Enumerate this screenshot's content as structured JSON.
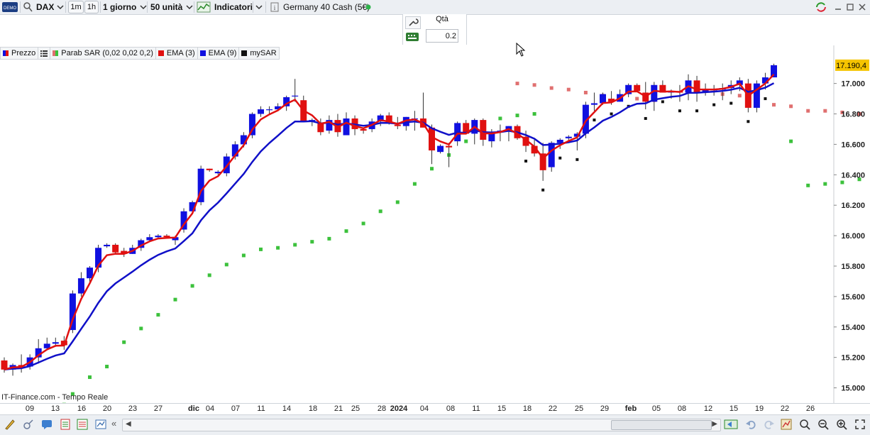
{
  "toolbar": {
    "symbol": "DAX",
    "interval_1m": "1m",
    "interval_1h": "1h",
    "period": "1 giorno",
    "units": "50 unità",
    "indicators": "Indicatori",
    "instrument": "Germany 40 Cash (5€)",
    "status_color": "#2db34a"
  },
  "order_panel": {
    "qty_label": "Qtà",
    "qty_value": "0.2"
  },
  "legend": {
    "price": "Prezzo",
    "parab_sar": "Parab SAR (0,02 0,02 0,2)",
    "ema3": "EMA (3)",
    "ema9": "EMA (9)",
    "mysar": "mySAR"
  },
  "colors": {
    "up": "#1010e0",
    "down": "#e01010",
    "ema3": "#e01010",
    "ema9": "#1010c8",
    "sar_green": "#3cc13c",
    "sar_red": "#e07070",
    "mysar": "#111111",
    "last_price_bg": "#f5c400"
  },
  "last_price": "17.190,4",
  "y_ticks": [
    "17.000",
    "16.800",
    "16.600",
    "16.400",
    "16.200",
    "16.000",
    "15.800",
    "15.600",
    "15.400",
    "15.200",
    "15.000"
  ],
  "x_labels": [
    "09",
    "13",
    "16",
    "20",
    "23",
    "27",
    "dic",
    "04",
    "07",
    "11",
    "14",
    "18",
    "21",
    "25",
    "28",
    "2024",
    "04",
    "08",
    "11",
    "15",
    "18",
    "22",
    "25",
    "29",
    "feb",
    "05",
    "08",
    "12",
    "15",
    "19",
    "22",
    "26"
  ],
  "watermark": "IT-Finance.com - Tempo Reale",
  "chart_data": {
    "type": "candlestick",
    "series": [
      {
        "name": "Prezzo",
        "ohlc": [
          [
            15180,
            15200,
            15100,
            15120
          ],
          [
            15120,
            15160,
            15080,
            15150
          ],
          [
            15150,
            15220,
            15100,
            15140
          ],
          [
            15140,
            15220,
            15120,
            15200
          ],
          [
            15200,
            15320,
            15160,
            15260
          ],
          [
            15260,
            15330,
            15250,
            15290
          ],
          [
            15290,
            15330,
            15270,
            15300
          ],
          [
            15310,
            15340,
            15250,
            15280
          ],
          [
            15380,
            15640,
            15360,
            15620
          ],
          [
            15620,
            15760,
            15600,
            15720
          ],
          [
            15720,
            15800,
            15680,
            15790
          ],
          [
            15790,
            15940,
            15760,
            15920
          ],
          [
            15930,
            15950,
            15920,
            15940
          ],
          [
            15940,
            15950,
            15880,
            15890
          ],
          [
            15900,
            15920,
            15860,
            15880
          ],
          [
            15880,
            15940,
            15880,
            15920
          ],
          [
            15920,
            15980,
            15900,
            15970
          ],
          [
            15970,
            16010,
            15960,
            15990
          ],
          [
            15990,
            16010,
            15980,
            16000
          ],
          [
            16000,
            16010,
            15980,
            15990
          ],
          [
            15970,
            16000,
            15940,
            15990
          ],
          [
            16040,
            16180,
            16020,
            16160
          ],
          [
            16160,
            16230,
            16140,
            16220
          ],
          [
            16220,
            16460,
            16200,
            16440
          ],
          [
            16440,
            16440,
            16420,
            16430
          ],
          [
            16410,
            16430,
            16400,
            16420
          ],
          [
            16410,
            16540,
            16390,
            16520
          ],
          [
            16520,
            16620,
            16500,
            16600
          ],
          [
            16600,
            16680,
            16580,
            16660
          ],
          [
            16660,
            16810,
            16640,
            16800
          ],
          [
            16800,
            16850,
            16780,
            16830
          ],
          [
            16830,
            16850,
            16800,
            16830
          ],
          [
            16830,
            16870,
            16820,
            16850
          ],
          [
            16850,
            16920,
            16820,
            16910
          ],
          [
            16920,
            17030,
            16880,
            16920
          ],
          [
            16890,
            16920,
            16830,
            16750
          ],
          [
            16750,
            16770,
            16720,
            16760
          ],
          [
            16740,
            16770,
            16660,
            16680
          ],
          [
            16690,
            16790,
            16670,
            16760
          ],
          [
            16760,
            16800,
            16650,
            16680
          ],
          [
            16660,
            16810,
            16660,
            16770
          ],
          [
            16770,
            16790,
            16660,
            16700
          ],
          [
            16700,
            16710,
            16670,
            16690
          ],
          [
            16700,
            16770,
            16680,
            16750
          ],
          [
            16750,
            16800,
            16720,
            16790
          ],
          [
            16790,
            16810,
            16730,
            16740
          ],
          [
            16730,
            16780,
            16700,
            16720
          ],
          [
            16720,
            16780,
            16690,
            16780
          ],
          [
            16770,
            16820,
            16690,
            16770
          ],
          [
            16770,
            16940,
            16740,
            16710
          ],
          [
            16710,
            16730,
            16470,
            16560
          ],
          [
            16550,
            16600,
            16540,
            16590
          ],
          [
            16590,
            16610,
            16450,
            16580
          ],
          [
            16620,
            16750,
            16590,
            16740
          ],
          [
            16740,
            16760,
            16670,
            16670
          ],
          [
            16670,
            16770,
            16600,
            16760
          ],
          [
            16760,
            16770,
            16590,
            16630
          ],
          [
            16620,
            16700,
            16580,
            16670
          ],
          [
            16690,
            16730,
            16620,
            16690
          ],
          [
            16690,
            16720,
            16620,
            16720
          ],
          [
            16720,
            16730,
            16630,
            16640
          ],
          [
            16650,
            16690,
            16550,
            16590
          ],
          [
            16590,
            16630,
            16520,
            16540
          ],
          [
            16540,
            16610,
            16360,
            16430
          ],
          [
            16450,
            16620,
            16420,
            16610
          ],
          [
            16610,
            16640,
            16570,
            16630
          ],
          [
            16640,
            16660,
            16620,
            16650
          ],
          [
            16650,
            16680,
            16560,
            16670
          ],
          [
            16670,
            16880,
            16640,
            16860
          ],
          [
            16860,
            16940,
            16820,
            16870
          ],
          [
            16870,
            16940,
            16860,
            16930
          ],
          [
            16900,
            16950,
            16860,
            16880
          ],
          [
            16880,
            16960,
            16880,
            16930
          ],
          [
            16930,
            17000,
            16910,
            16990
          ],
          [
            16990,
            17000,
            16960,
            16950
          ],
          [
            16940,
            17010,
            16830,
            16880
          ],
          [
            16880,
            17010,
            16820,
            16990
          ],
          [
            16990,
            17020,
            16940,
            16940
          ],
          [
            16940,
            16960,
            16900,
            16950
          ],
          [
            16950,
            16990,
            16880,
            16940
          ],
          [
            16940,
            17060,
            16890,
            17020
          ],
          [
            17020,
            17050,
            16880,
            16940
          ],
          [
            16940,
            17000,
            16920,
            16960
          ],
          [
            16960,
            16990,
            16920,
            16960
          ],
          [
            16960,
            17000,
            16890,
            16970
          ],
          [
            16970,
            17020,
            16930,
            16990
          ],
          [
            16990,
            17040,
            16950,
            17020
          ],
          [
            17000,
            17030,
            16810,
            16840
          ],
          [
            16840,
            17020,
            16810,
            17000
          ],
          [
            17000,
            17070,
            16960,
            17040
          ],
          [
            17040,
            17130,
            17040,
            17120
          ]
        ]
      },
      {
        "name": "EMA (3)"
      },
      {
        "name": "EMA (9)"
      },
      {
        "name": "mySAR"
      }
    ],
    "ylim": [
      14900,
      17250
    ],
    "y_ticks": [
      15000,
      15200,
      15400,
      15600,
      15800,
      16000,
      16200,
      16400,
      16600,
      16800,
      17000
    ],
    "sar_green": [
      [
        4,
        14810
      ],
      [
        7,
        14890
      ],
      [
        8,
        14960
      ],
      [
        10,
        15070
      ],
      [
        12,
        15140
      ],
      [
        14,
        15300
      ],
      [
        16,
        15390
      ],
      [
        18,
        15480
      ],
      [
        20,
        15580
      ],
      [
        22,
        15670
      ],
      [
        24,
        15740
      ],
      [
        26,
        15810
      ],
      [
        28,
        15870
      ],
      [
        30,
        15910
      ],
      [
        32,
        15920
      ],
      [
        34,
        15940
      ],
      [
        36,
        15960
      ],
      [
        38,
        15980
      ],
      [
        40,
        16030
      ],
      [
        42,
        16080
      ],
      [
        44,
        16160
      ],
      [
        46,
        16220
      ],
      [
        48,
        16340
      ],
      [
        50,
        16440
      ],
      [
        52,
        16530
      ],
      [
        54,
        16620
      ],
      [
        56,
        16710
      ],
      [
        58,
        16770
      ],
      [
        60,
        16790
      ],
      [
        62,
        16800
      ],
      [
        92,
        16620
      ],
      [
        94,
        16330
      ],
      [
        96,
        16340
      ],
      [
        98,
        16350
      ],
      [
        100,
        16370
      ],
      [
        102,
        16400
      ],
      [
        104,
        16420
      ],
      [
        106,
        16460
      ],
      [
        108,
        16500
      ],
      [
        110,
        16540
      ],
      [
        112,
        16580
      ],
      [
        114,
        16610
      ],
      [
        116,
        16660
      ],
      [
        118,
        16700
      ],
      [
        120,
        16740
      ],
      [
        122,
        16780
      ],
      [
        124,
        16810
      ],
      [
        126,
        16840
      ],
      [
        128,
        16860
      ],
      [
        130,
        16880
      ],
      [
        132,
        16900
      ],
      [
        134,
        16930
      ],
      [
        140,
        16780
      ],
      [
        142,
        16790
      ]
    ],
    "sar_red": [
      [
        60,
        17000
      ],
      [
        62,
        16990
      ],
      [
        64,
        16970
      ],
      [
        66,
        16960
      ],
      [
        68,
        16940
      ],
      [
        70,
        16920
      ],
      [
        72,
        16910
      ],
      [
        74,
        16900
      ],
      [
        76,
        16890
      ],
      [
        80,
        16950
      ],
      [
        82,
        16950
      ],
      [
        84,
        16930
      ],
      [
        86,
        16920
      ],
      [
        88,
        16900
      ],
      [
        90,
        16860
      ],
      [
        92,
        16850
      ],
      [
        94,
        16820
      ],
      [
        96,
        16820
      ],
      [
        98,
        16810
      ],
      [
        100,
        16800
      ],
      [
        102,
        16790
      ],
      [
        104,
        16780
      ],
      [
        106,
        16760
      ],
      [
        108,
        16720
      ],
      [
        110,
        16700
      ],
      [
        112,
        16680
      ],
      [
        134,
        17050
      ],
      [
        136,
        17050
      ],
      [
        138,
        17040
      ],
      [
        140,
        17030
      ]
    ]
  }
}
